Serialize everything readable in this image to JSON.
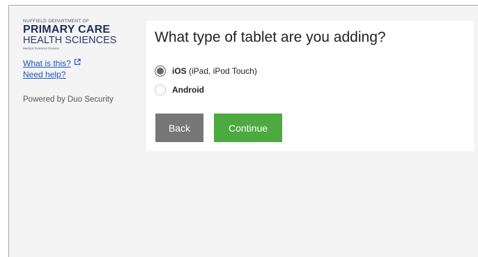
{
  "sidebar": {
    "logo": {
      "dept": "NUFFIELD DEPARTMENT OF",
      "line1": "PRIMARY CARE",
      "line2": "HEALTH SCIENCES",
      "division": "Medical Sciences Division"
    },
    "what_is_this": "What is this?",
    "need_help": "Need help?",
    "powered_by": "Powered by Duo Security"
  },
  "main": {
    "title": "What type of tablet are you adding?",
    "options": [
      {
        "name": "iOS",
        "detail": " (iPad, iPod Touch)",
        "checked": true
      },
      {
        "name": "Android",
        "detail": "",
        "checked": false
      }
    ],
    "back_label": "Back",
    "continue_label": "Continue"
  },
  "colors": {
    "continue_button": "#4caa40",
    "back_button": "#777777",
    "link": "#1a55c4",
    "logo_navy": "#1f2d5a",
    "background": "#f4f4f4"
  }
}
